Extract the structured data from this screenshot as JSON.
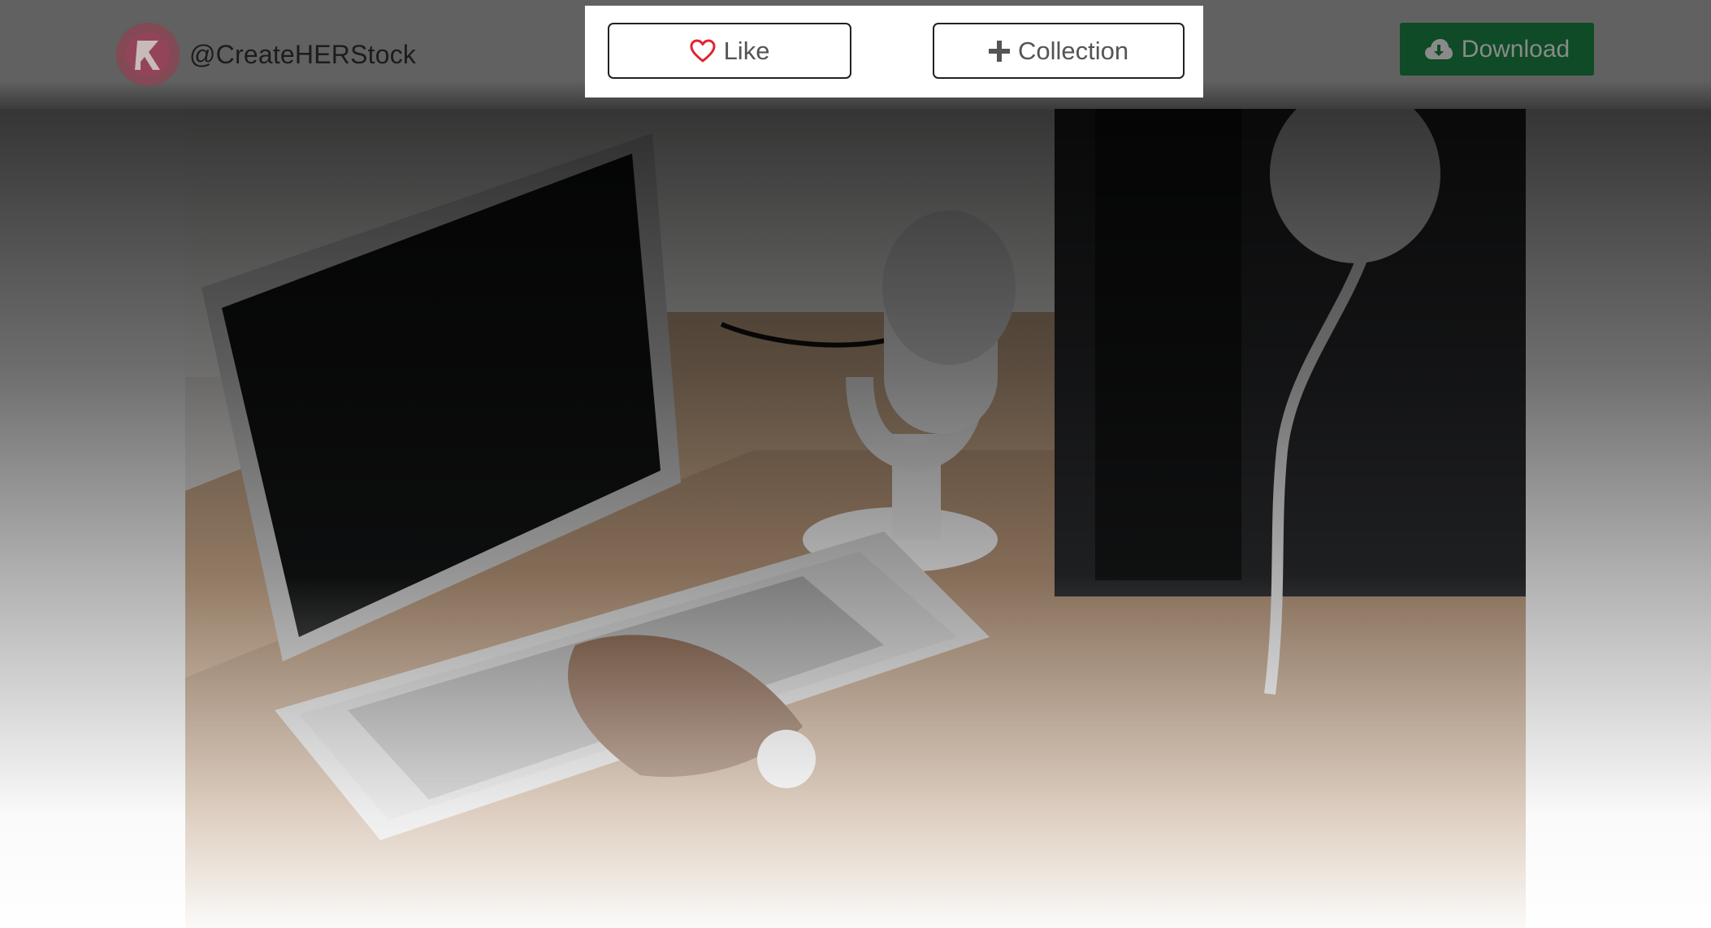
{
  "author": {
    "handle": "@CreateHERStock",
    "avatar_icon": "createherstock-logo-avatar"
  },
  "actions": {
    "like_label": "Like",
    "like_icon": "heart-outline-icon",
    "collection_label": "Collection",
    "collection_icon": "plus-icon",
    "download_label": "Download",
    "download_icon": "cloud-download-icon"
  },
  "colors": {
    "download_bg": "#0f4b26",
    "heart": "#e0242e",
    "panel_bg": "#ffffff",
    "overlay_dark": "#000000"
  },
  "photo": {
    "subject": "photo-laptop-microphone-desk"
  }
}
